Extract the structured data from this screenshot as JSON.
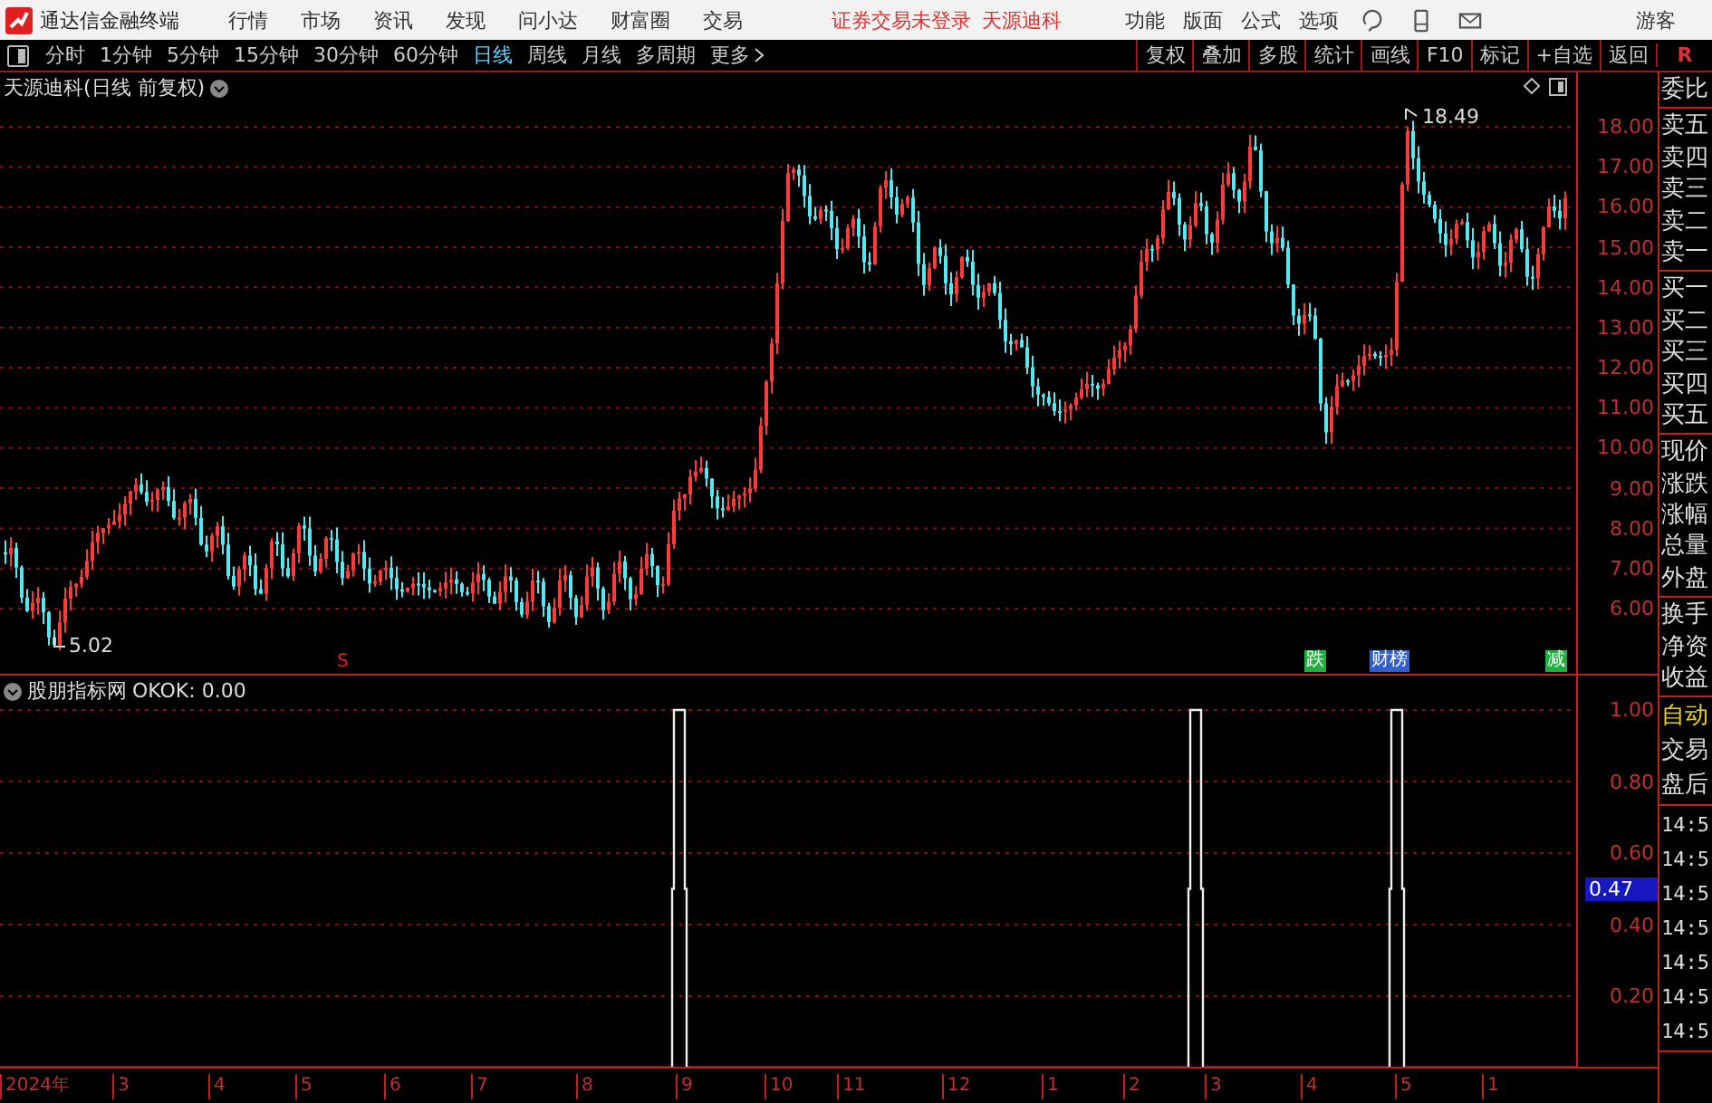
{
  "app_bar": {
    "title": "通达信金融终端",
    "menus": [
      "行情",
      "市场",
      "资讯",
      "发现",
      "问小达",
      "财富圈",
      "交易"
    ],
    "notice": "证券交易未登录",
    "stock_link": "天源迪科",
    "tools": [
      "功能",
      "版面",
      "公式",
      "选项"
    ],
    "user": "游客"
  },
  "toolbar": {
    "periods": [
      {
        "label": "分时",
        "selected": false
      },
      {
        "label": "1分钟",
        "selected": false
      },
      {
        "label": "5分钟",
        "selected": false
      },
      {
        "label": "15分钟",
        "selected": false
      },
      {
        "label": "30分钟",
        "selected": false
      },
      {
        "label": "60分钟",
        "selected": false
      },
      {
        "label": "日线",
        "selected": true
      },
      {
        "label": "周线",
        "selected": false
      },
      {
        "label": "月线",
        "selected": false
      },
      {
        "label": "多周期",
        "selected": false
      }
    ],
    "more": "更多",
    "actions": [
      "复权",
      "叠加",
      "多股",
      "统计",
      "画线",
      "F10",
      "标记",
      "+自选",
      "返回"
    ],
    "corner": "R"
  },
  "price_chart": {
    "title": "天源迪科(日线 前复权)",
    "y_ticks": [
      "18.00",
      "17.00",
      "16.00",
      "15.00",
      "14.00",
      "13.00",
      "12.00",
      "11.00",
      "10.00",
      "9.00",
      "8.00",
      "7.00",
      "6.00"
    ],
    "high_label": "18.49",
    "low_label": "5.02",
    "signals": [
      {
        "text": "S",
        "color": "#e02020"
      },
      {
        "text": "跌",
        "color": "#20b040"
      },
      {
        "text": "财榜",
        "color": "#3060d0"
      },
      {
        "text": "减",
        "color": "#20b040"
      }
    ]
  },
  "indicator": {
    "title": "股朋指标网",
    "reading": "OKOK: 0.00",
    "y_ticks": [
      "1.00",
      "0.80",
      "0.60",
      "0.40",
      "0.20"
    ],
    "cursor_value": "0.47"
  },
  "time_axis": [
    "2024年",
    "3",
    "4",
    "5",
    "6",
    "7",
    "8",
    "9",
    "10",
    "11",
    "12",
    "1",
    "2",
    "3",
    "4",
    "5",
    "1"
  ],
  "side_panel": [
    {
      "kind": "quote",
      "items": [
        {
          "label": "委比"
        }
      ]
    },
    {
      "kind": "quote",
      "items": [
        {
          "label": "卖五"
        },
        {
          "label": "卖四"
        },
        {
          "label": "卖三"
        },
        {
          "label": "卖二"
        },
        {
          "label": "卖一"
        }
      ]
    },
    {
      "kind": "quote",
      "items": [
        {
          "label": "买一"
        },
        {
          "label": "买二"
        },
        {
          "label": "买三"
        },
        {
          "label": "买四"
        },
        {
          "label": "买五"
        }
      ]
    },
    {
      "kind": "quote",
      "items": [
        {
          "label": "现价"
        },
        {
          "label": "涨跌"
        },
        {
          "label": "涨幅"
        },
        {
          "label": "总量"
        },
        {
          "label": "外盘"
        }
      ]
    },
    {
      "kind": "quote",
      "items": [
        {
          "label": "换手"
        },
        {
          "label": "净资"
        },
        {
          "label": "收益"
        }
      ]
    },
    {
      "kind": "tabs",
      "items": [
        {
          "label": "自动",
          "selected": true
        },
        {
          "label": "交易",
          "selected": false
        },
        {
          "label": "盘后",
          "selected": false
        }
      ]
    },
    {
      "kind": "ticks",
      "items": [
        {
          "label": "14:5"
        },
        {
          "label": "14:5"
        },
        {
          "label": "14:5"
        },
        {
          "label": "14:5"
        },
        {
          "label": "14:5"
        },
        {
          "label": "14:5"
        },
        {
          "label": "14:5"
        }
      ]
    }
  ]
}
